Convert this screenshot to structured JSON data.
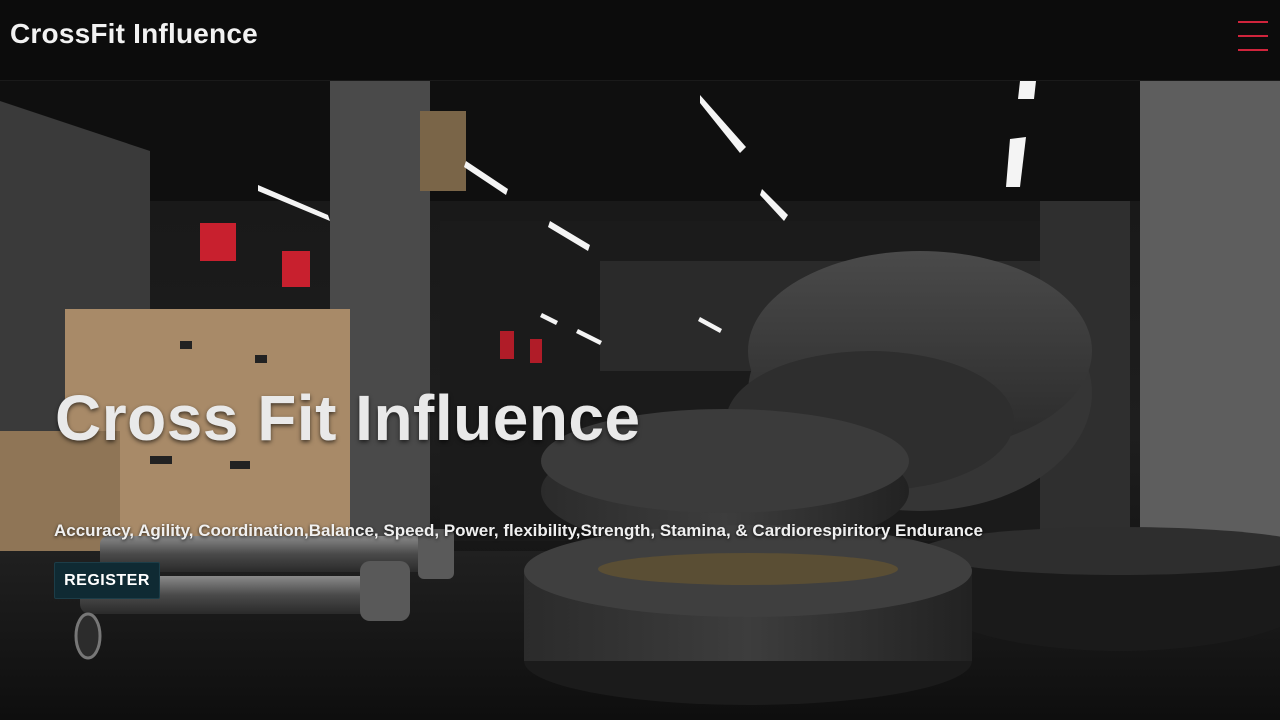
{
  "header": {
    "brand": "CrossFit Influence",
    "menu_icon": "hamburger-menu-icon",
    "menu_color": "#d0243c"
  },
  "hero": {
    "title": "Cross Fit Influence",
    "subtitle": "Accuracy, Agility, Coordination,Balance, Speed, Power, flexibility,Strength, Stamina, & Cardiorespiritory Endurance",
    "register_label": "REGISTER",
    "register_color": "#0f2a33",
    "background_image": "gym-weight-plates-photo"
  }
}
